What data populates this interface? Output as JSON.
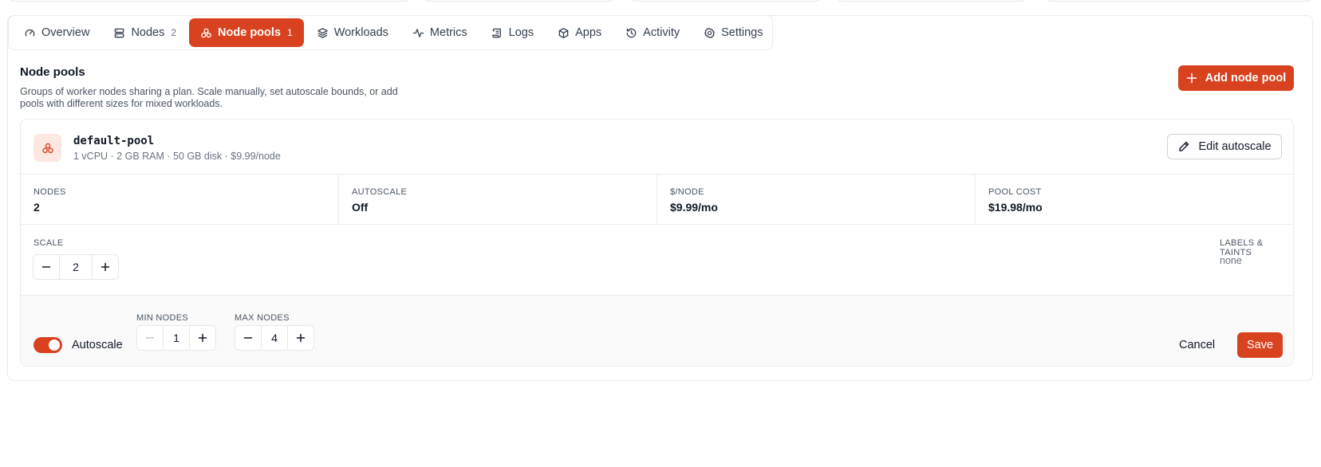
{
  "tabs": [
    {
      "label": "Overview",
      "icon": "gauge-icon",
      "count": ""
    },
    {
      "label": "Nodes",
      "icon": "server-icon",
      "count": "2"
    },
    {
      "label": "Node pools",
      "icon": "node-pools-icon",
      "count": "1",
      "active": true
    },
    {
      "label": "Workloads",
      "icon": "layers-icon",
      "count": ""
    },
    {
      "label": "Metrics",
      "icon": "activity-icon",
      "count": ""
    },
    {
      "label": "Logs",
      "icon": "scroll-icon",
      "count": ""
    },
    {
      "label": "Apps",
      "icon": "package-icon",
      "count": ""
    },
    {
      "label": "Activity",
      "icon": "history-icon",
      "count": ""
    },
    {
      "label": "Settings",
      "icon": "gear-icon",
      "count": ""
    }
  ],
  "section": {
    "title": "Node pools",
    "description": "Groups of worker nodes sharing a plan. Scale manually, set autoscale bounds, or add pools with different sizes for mixed workloads.",
    "add_button": "Add node pool"
  },
  "pool": {
    "name": "default-pool",
    "spec": "1 vCPU · 2 GB RAM · 50 GB disk · $9.99/node",
    "edit_button": "Edit autoscale",
    "stats": [
      {
        "label": "NODES",
        "value": "2"
      },
      {
        "label": "AUTOSCALE",
        "value": "Off"
      },
      {
        "label": "$/NODE",
        "value": "$9.99/mo"
      },
      {
        "label": "POOL COST",
        "value": "$19.98/mo"
      }
    ],
    "scale": {
      "label": "SCALE",
      "value": "2"
    },
    "labels_taints": {
      "label": "LABELS & TAINTS",
      "value": "none"
    },
    "autoscale": {
      "toggle_label": "Autoscale",
      "enabled": true,
      "min": {
        "label": "MIN NODES",
        "value": "1"
      },
      "max": {
        "label": "MAX NODES",
        "value": "4"
      },
      "cancel": "Cancel",
      "save": "Save"
    }
  },
  "colors": {
    "accent": "#d9421f",
    "accent_soft": "#fde7e1"
  }
}
